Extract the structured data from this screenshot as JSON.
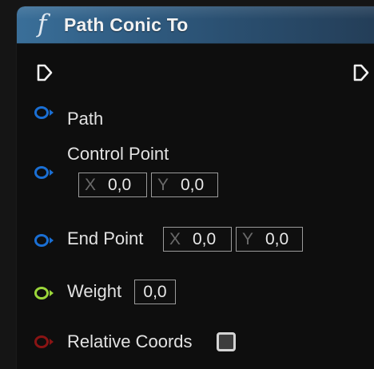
{
  "node": {
    "title": "Path Conic To",
    "function_glyph": "f",
    "icon": "function-icon",
    "colors": {
      "header": "#305d83",
      "body": "#0e0e0e",
      "vector_pin": "#1a6fd4",
      "float_pin": "#9bd63a",
      "bool_pin": "#8a1414"
    }
  },
  "pins": {
    "path": {
      "label": "Path",
      "icon": "vector-pin-icon"
    },
    "control_point": {
      "label": "Control Point",
      "icon": "vector-pin-icon",
      "x_axis": "X",
      "x_value": "0,0",
      "y_axis": "Y",
      "y_value": "0,0"
    },
    "end_point": {
      "label": "End Point",
      "icon": "vector-pin-icon",
      "x_axis": "X",
      "x_value": "0,0",
      "y_axis": "Y",
      "y_value": "0,0"
    },
    "weight": {
      "label": "Weight",
      "icon": "float-pin-icon",
      "value": "0,0"
    },
    "relative_coords": {
      "label": "Relative Coords",
      "icon": "bool-pin-icon",
      "checked": false
    }
  }
}
